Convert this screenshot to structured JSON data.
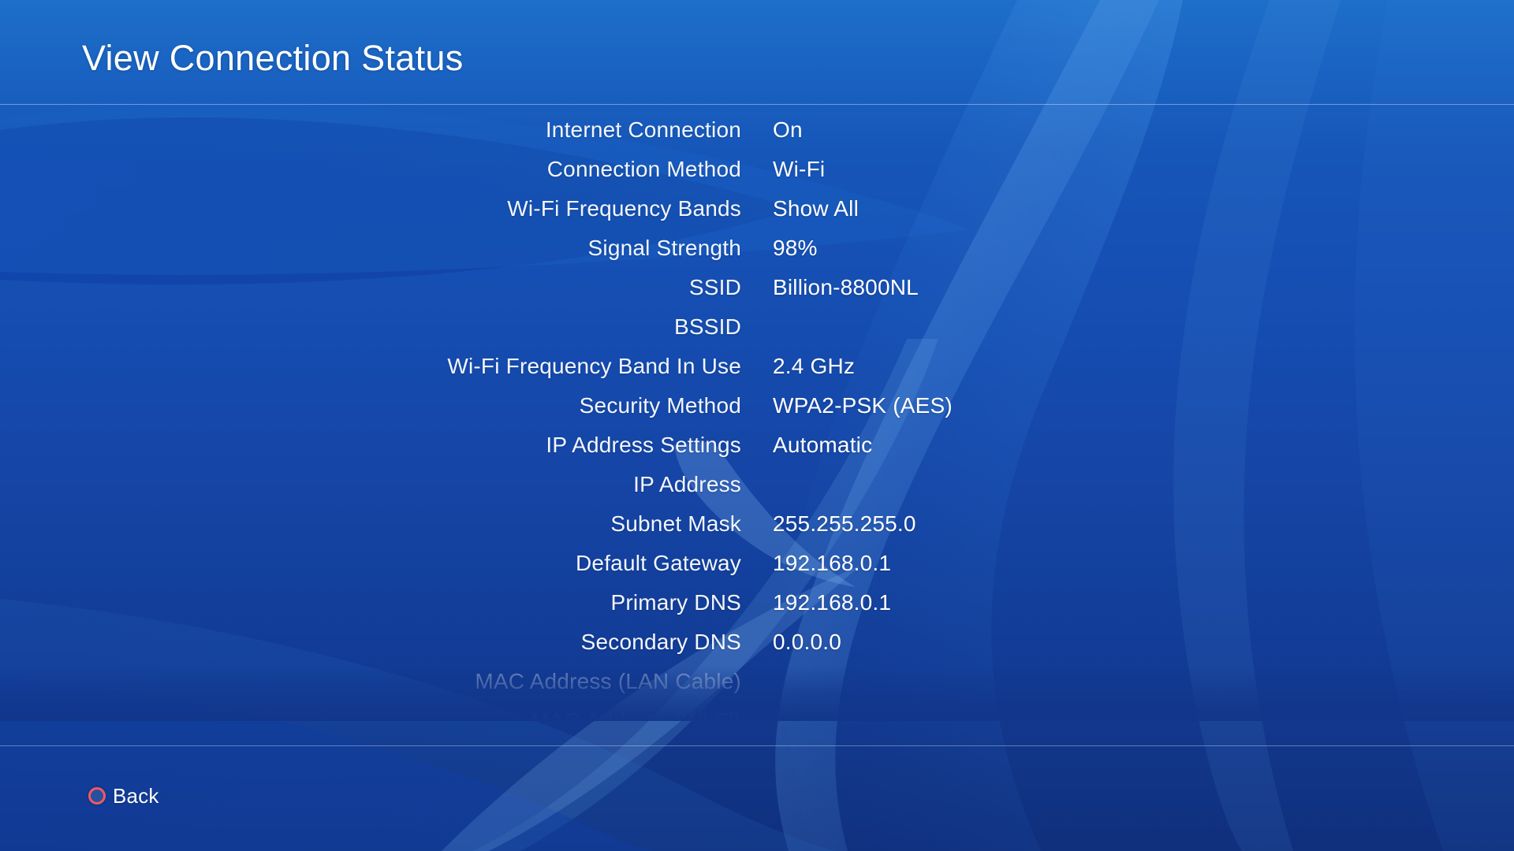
{
  "header": {
    "title": "View Connection Status"
  },
  "colors": {
    "accent_circle": "#ef5a63",
    "background_top": "#1d6fc9",
    "background_bottom": "#102f7c",
    "text": "#ffffff"
  },
  "connection_status": {
    "rows": [
      {
        "label": "Internet Connection",
        "value": "On"
      },
      {
        "label": "Connection Method",
        "value": "Wi-Fi"
      },
      {
        "label": "Wi-Fi Frequency Bands",
        "value": "Show All"
      },
      {
        "label": "Signal Strength",
        "value": "98%"
      },
      {
        "label": "SSID",
        "value": "Billion-8800NL"
      },
      {
        "label": "BSSID",
        "value": ""
      },
      {
        "label": "Wi-Fi Frequency Band In Use",
        "value": "2.4 GHz"
      },
      {
        "label": "Security Method",
        "value": "WPA2-PSK (AES)"
      },
      {
        "label": "IP Address Settings",
        "value": "Automatic"
      },
      {
        "label": "IP Address",
        "value": ""
      },
      {
        "label": "Subnet Mask",
        "value": "255.255.255.0"
      },
      {
        "label": "Default Gateway",
        "value": "192.168.0.1"
      },
      {
        "label": "Primary DNS",
        "value": "192.168.0.1"
      },
      {
        "label": "Secondary DNS",
        "value": "0.0.0.0"
      },
      {
        "label": "MAC Address (LAN Cable)",
        "value": ""
      },
      {
        "label": "MAC Address (Wi-Fi)",
        "value": ""
      }
    ]
  },
  "footer": {
    "back_label": "Back",
    "back_icon": "circle-button-icon"
  }
}
